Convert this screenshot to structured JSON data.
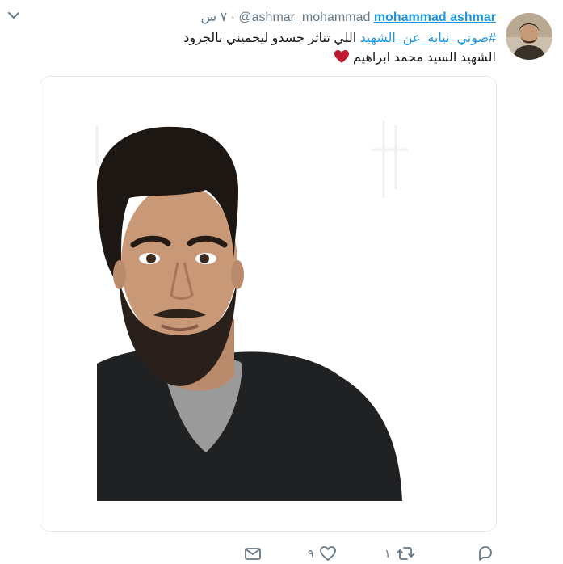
{
  "tweet": {
    "display_name": "mohammad ashmar",
    "handle": "@ashmar_mohammad",
    "time": "٧ س",
    "separator": "·",
    "hashtag": "#صوتي_نيابة_عن_الشهيد",
    "text_line1_rest": " اللي تناثر جسدو ليحميني بالجرود",
    "text_line2": "الشهيد السيد محمد ابراهيم "
  },
  "actions": {
    "reply_count": "",
    "retweet_count": "١",
    "like_count": "٩"
  },
  "icons": {
    "menu": "chevron-down-icon",
    "reply": "reply-icon",
    "retweet": "retweet-icon",
    "like": "heart-icon",
    "dm": "envelope-icon",
    "emoji": "red-heart-emoji"
  },
  "colors": {
    "link": "#1b95e0",
    "muted": "#657786",
    "heart_emoji": "#be1931"
  }
}
